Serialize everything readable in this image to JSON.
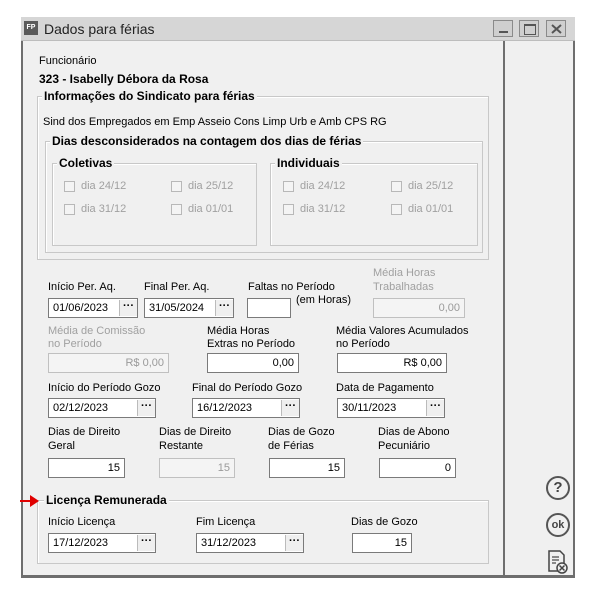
{
  "window": {
    "title": "Dados para férias",
    "icon_text": "FP",
    "controls": [
      "minimize-icon",
      "maximize-icon",
      "close-icon"
    ]
  },
  "employee": {
    "label": "Funcionário",
    "name": "323 - Isabelly Débora da Rosa"
  },
  "union_group": {
    "title": "Informações do Sindicato para férias",
    "union_name": "Sind dos Empregados em Emp Asseio Cons Limp Urb e Amb CPS RG"
  },
  "disregarded_group": {
    "title": "Dias desconsiderados na contagem dos dias de férias",
    "collective": {
      "title": "Coletivas",
      "items": [
        {
          "label": "dia 24/12",
          "checked": false
        },
        {
          "label": "dia 25/12",
          "checked": false
        },
        {
          "label": "dia 31/12",
          "checked": false
        },
        {
          "label": "dia 01/01",
          "checked": false
        }
      ]
    },
    "individual": {
      "title": "Individuais",
      "items": [
        {
          "label": "dia 24/12",
          "checked": false
        },
        {
          "label": "dia 25/12",
          "checked": false
        },
        {
          "label": "dia 31/12",
          "checked": false
        },
        {
          "label": "dia 01/01",
          "checked": false
        }
      ]
    }
  },
  "fields": {
    "inicio_per_aq": {
      "label": "Início Per. Aq.",
      "value": "01/06/2023"
    },
    "final_per_aq": {
      "label": "Final Per. Aq.",
      "value": "31/05/2024"
    },
    "faltas": {
      "label": "Faltas no Período",
      "value": "",
      "unit": "(em Horas)"
    },
    "media_horas_trab": {
      "label1": "Média Horas",
      "label2": "Trabalhadas",
      "value": "0,00"
    },
    "media_comissao": {
      "label1": "Média de Comissão",
      "label2": "no Período",
      "value": "R$ 0,00"
    },
    "media_horas_extras": {
      "label1": "Média Horas",
      "label2": "Extras no Período",
      "value": "0,00"
    },
    "media_valores": {
      "label1": "Média Valores Acumulados",
      "label2": "no Período",
      "value": "R$ 0,00"
    },
    "inicio_gozo": {
      "label": "Início do Período Gozo",
      "value": "02/12/2023"
    },
    "final_gozo": {
      "label": "Final do Período Gozo",
      "value": "16/12/2023"
    },
    "data_pagamento": {
      "label": "Data de Pagamento",
      "value": "30/11/2023"
    },
    "dias_direito_geral": {
      "label1": "Dias de Direito",
      "label2": "Geral",
      "value": "15"
    },
    "dias_direito_restante": {
      "label1": "Dias de Direito",
      "label2": "Restante",
      "value": "15"
    },
    "dias_gozo_ferias": {
      "label1": "Dias de Gozo",
      "label2": "de Férias",
      "value": "15"
    },
    "dias_abono": {
      "label1": "Dias de Abono",
      "label2": "Pecuniário",
      "value": "0"
    }
  },
  "paid_leave": {
    "title": "Licença Remunerada",
    "inicio": {
      "label": "Início Licença",
      "value": "17/12/2023"
    },
    "fim": {
      "label": "Fim Licença",
      "value": "31/12/2023"
    },
    "dias": {
      "label": "Dias de Gozo",
      "value": "15"
    }
  },
  "side_buttons": {
    "help": "?",
    "ok": "ok"
  },
  "ellipsis": "···",
  "colors": {
    "arrow": "#e00000"
  }
}
